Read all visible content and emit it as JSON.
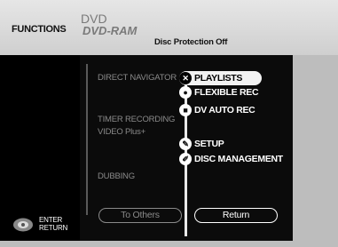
{
  "header": {
    "functions_label": "FUNCTIONS",
    "disc_line1": "DVD",
    "disc_line2": "DVD-RAM",
    "protection_text": "Disc Protection  Off"
  },
  "left_menu": [
    {
      "label": "DIRECT NAVIGATOR"
    },
    {
      "label": "TIMER RECORDING"
    },
    {
      "label": "VIDEO Plus+"
    },
    {
      "label": "DUBBING"
    }
  ],
  "right_menu": [
    {
      "label": "PLAYLISTS",
      "icon": "playlists-icon",
      "selected": true
    },
    {
      "label": "FLEXIBLE REC",
      "icon": "flexible-rec-icon"
    },
    {
      "label": "DV AUTO REC",
      "icon": "dv-icon"
    },
    {
      "label": "SETUP",
      "icon": "setup-icon"
    },
    {
      "label": "DISC MANAGEMENT",
      "icon": "disc-management-icon"
    }
  ],
  "buttons": {
    "to_others": "To Others",
    "return": "Return"
  },
  "legend": {
    "enter": "ENTER",
    "return": "RETURN"
  }
}
